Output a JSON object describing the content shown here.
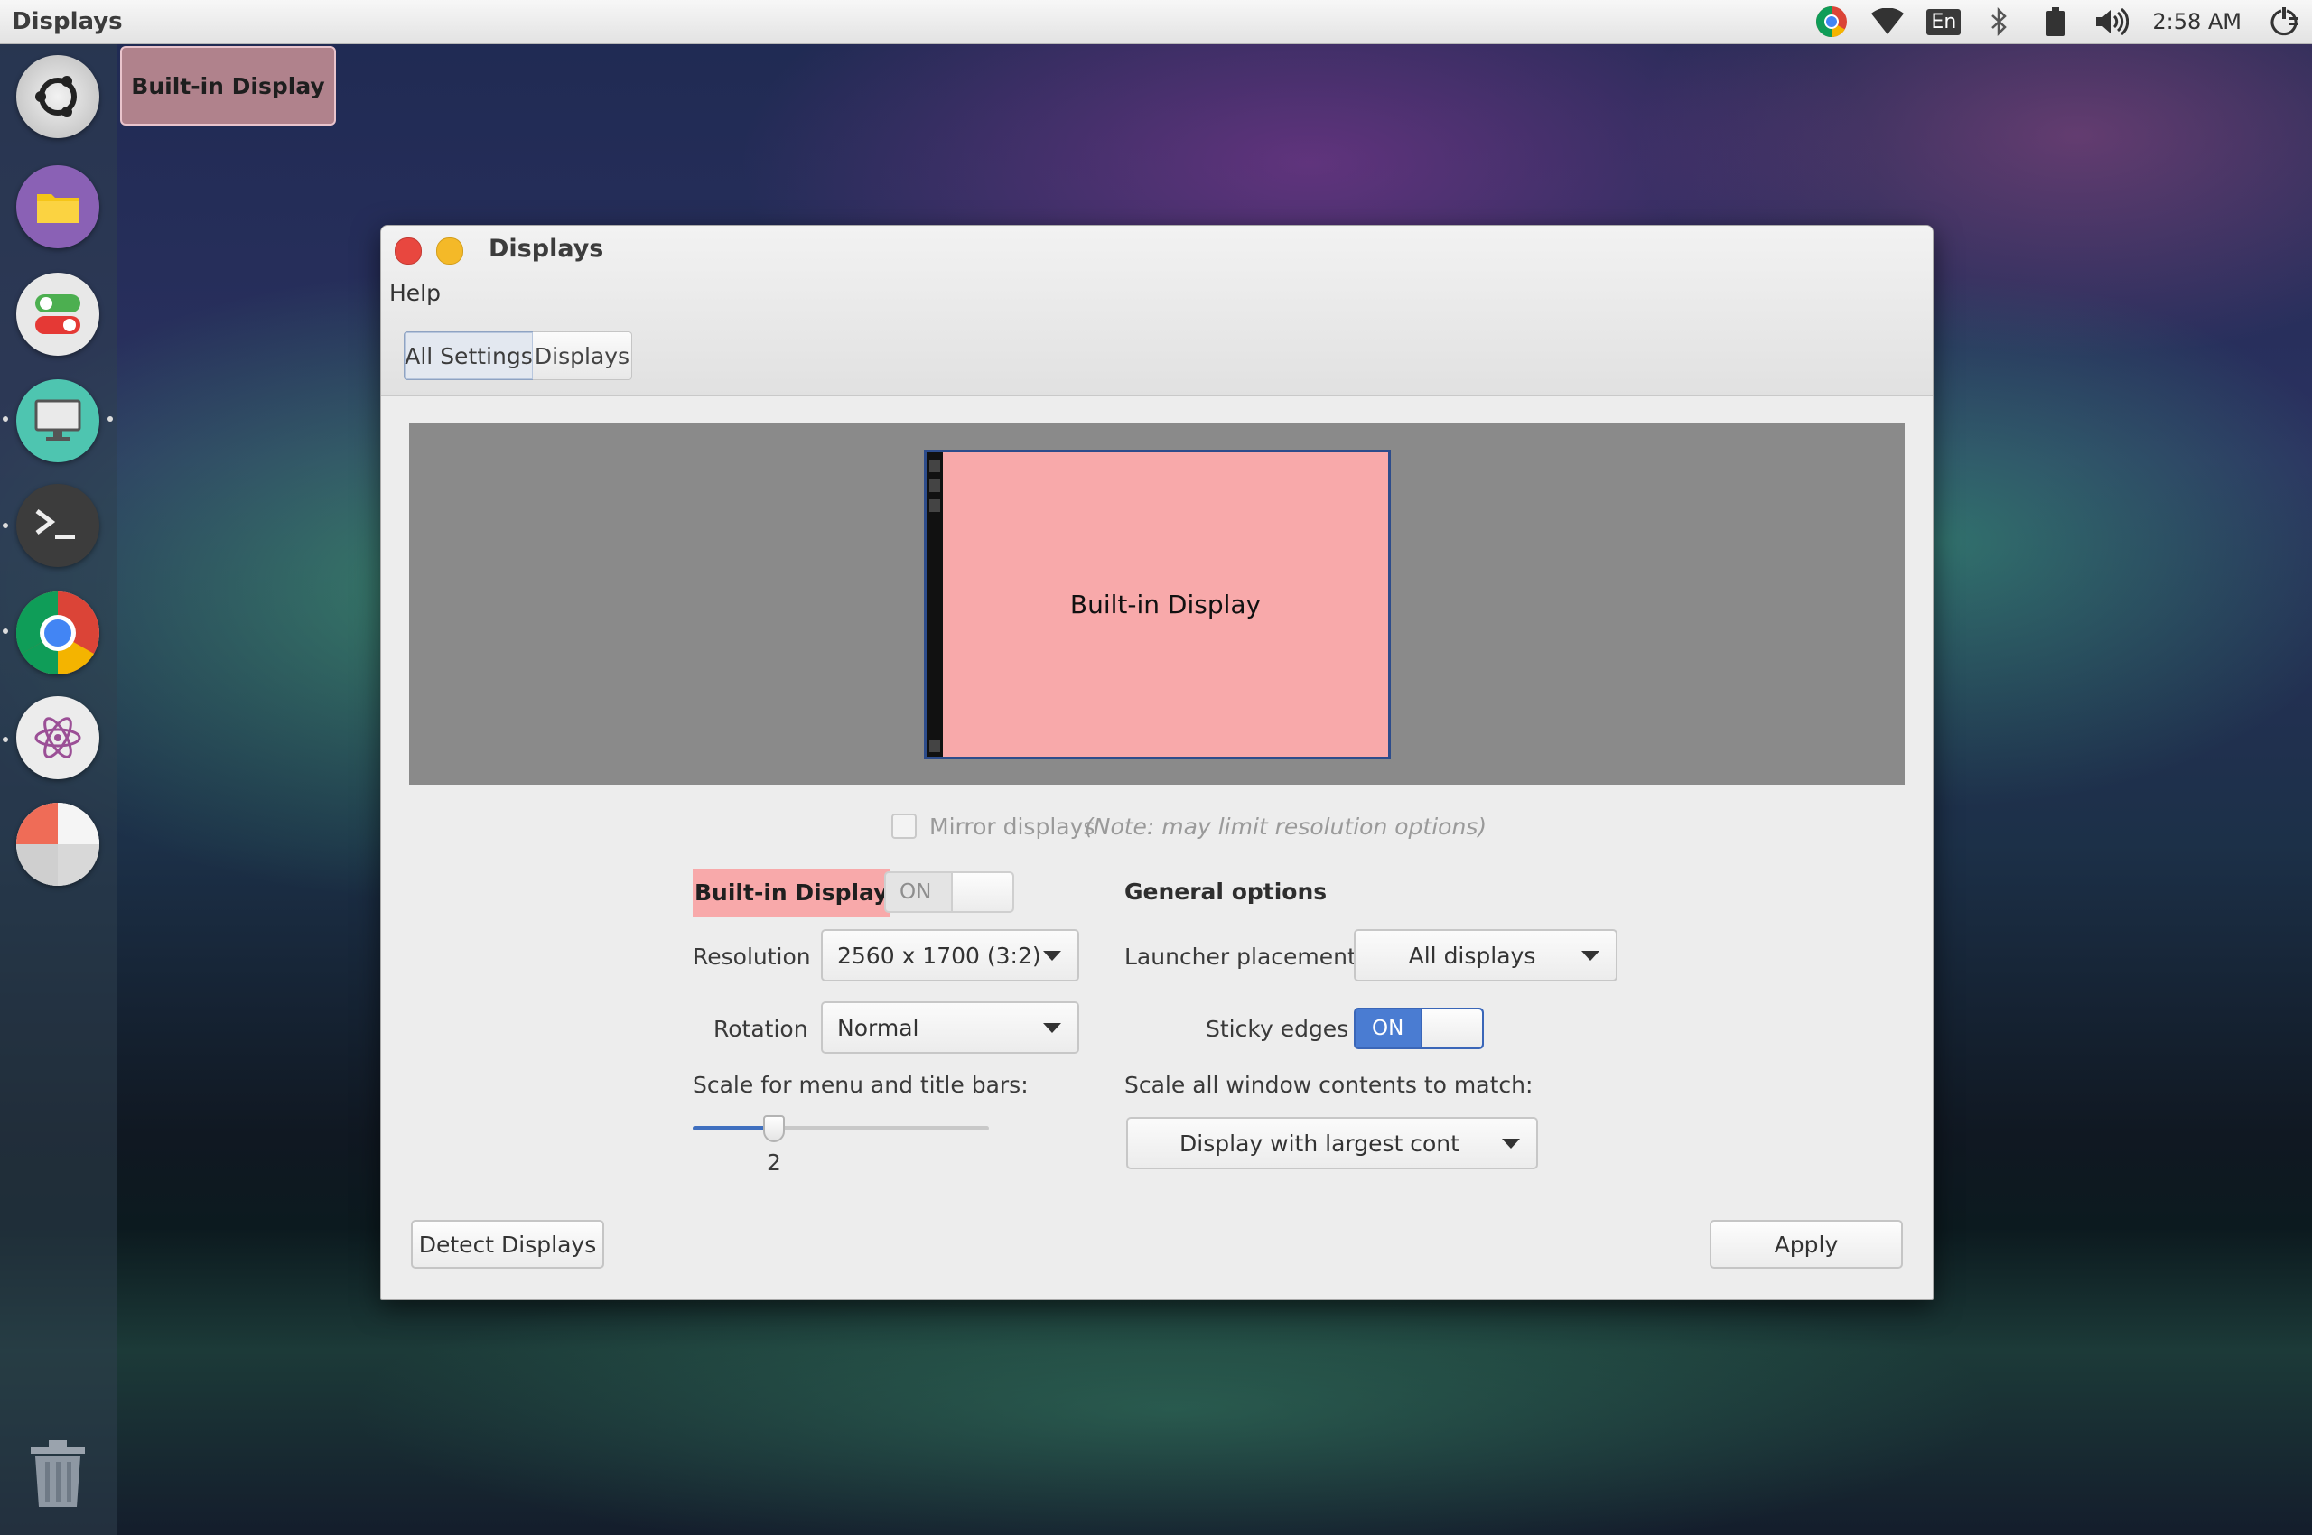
{
  "panel": {
    "app_title": "Displays",
    "keyboard_layout": "En",
    "clock": "2:58 AM",
    "icons": [
      "chrome-icon",
      "wifi-icon",
      "keyboard-icon",
      "bluetooth-icon",
      "battery-icon",
      "volume-icon",
      "power-icon"
    ]
  },
  "launcher": {
    "tooltip": "Built-in Display",
    "items": [
      "ubuntu-logo-icon",
      "files-icon",
      "settings-toggles-icon",
      "displays-monitor-icon",
      "terminal-icon",
      "chrome-icon",
      "atom-icon",
      "pie-chart-app-icon",
      "trash-icon"
    ]
  },
  "window": {
    "title": "Displays",
    "menu_help": "Help",
    "breadcrumbs": [
      "All Settings",
      "Displays"
    ],
    "preview_monitor_label": "Built-in Display",
    "mirror_label": "Mirror displays",
    "mirror_note": "(Note: may limit resolution options)",
    "display_name": "Built-in Display",
    "display_switch": "ON",
    "resolution_label": "Resolution",
    "resolution_value": "2560 x 1700 (3:2)",
    "rotation_label": "Rotation",
    "rotation_value": "Normal",
    "scale_label": "Scale for menu and title bars:",
    "scale_value": "2",
    "general_options": "General options",
    "launcher_placement_label": "Launcher placement",
    "launcher_placement_value": "All displays",
    "sticky_edges_label": "Sticky edges",
    "sticky_edges_switch": "ON",
    "scale_all_label": "Scale all window contents to match:",
    "scale_all_value": "Display with largest cont",
    "detect_button": "Detect Displays",
    "apply_button": "Apply"
  },
  "colors": {
    "highlight_pink": "#f8a9aa",
    "accent_blue": "#4a7cd2",
    "close_red": "#e8473f",
    "minimize_yellow": "#f4b928"
  }
}
